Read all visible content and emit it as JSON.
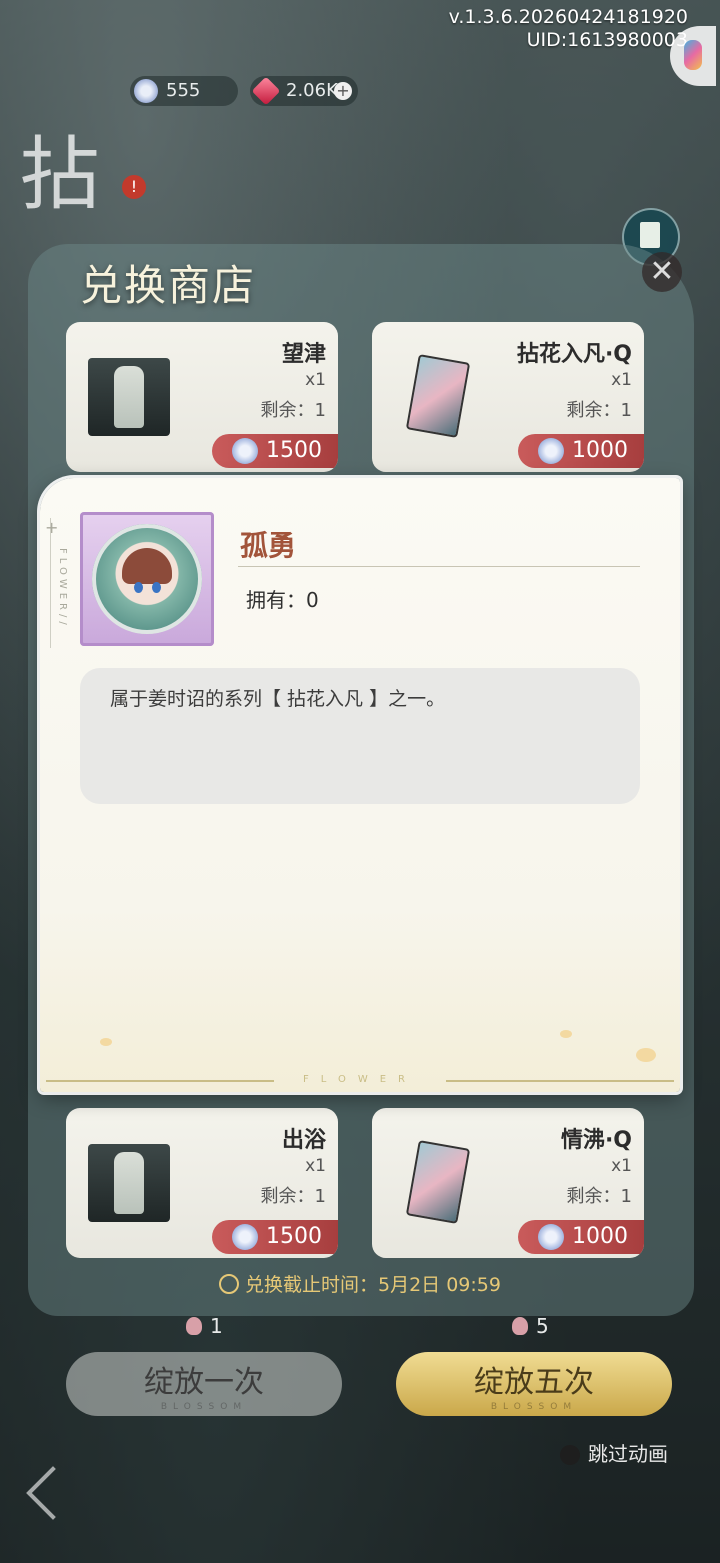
{
  "app": {
    "version": "v.1.3.6.20260424181920",
    "uid": "UID:1613980003"
  },
  "currency": {
    "flower_coin": "555",
    "gem": "2.06K",
    "gem_plus": "+"
  },
  "banner": {
    "deco_char": "拈",
    "alert": "!"
  },
  "shop": {
    "title": "兑换商店",
    "close": "✕",
    "items": [
      {
        "name": "望津",
        "qty": "x1",
        "remain": "剩余：1",
        "price": "1500"
      },
      {
        "name": "拈花入凡·Q",
        "qty": "x1",
        "remain": "剩余：1",
        "price": "1000"
      },
      {
        "name": "出浴",
        "qty": "x1",
        "remain": "剩余：1",
        "price": "1500"
      },
      {
        "name": "情沸·Q",
        "qty": "x1",
        "remain": "剩余：1",
        "price": "1000"
      }
    ],
    "deadline": "兑换截止时间：5月2日 09:59"
  },
  "draw": {
    "cost_single": "1",
    "cost_five": "5",
    "single_label": "绽放一次",
    "single_sub": "BLOSSOM",
    "five_label": "绽放五次",
    "five_sub": "BLOSSOM",
    "skip_label": "跳过动画"
  },
  "popup": {
    "title": "孤勇",
    "owned": "拥有：0",
    "description": "属于姜时诏的系列【 拈花入凡 】之一。",
    "side_text": "FLOWER//",
    "footer_text": "FLOWER"
  },
  "colors": {
    "accent_gold": "#e6c876",
    "title_brown": "#a2543a",
    "price_red": "#a33b3b"
  }
}
